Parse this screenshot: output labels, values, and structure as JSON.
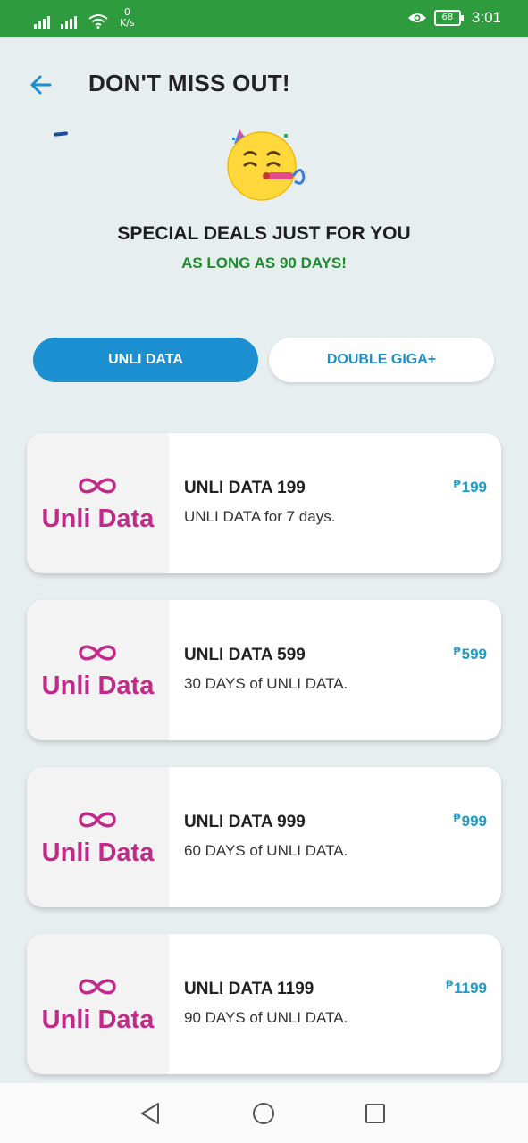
{
  "status_bar": {
    "speed_value": "0",
    "speed_unit": "K/s",
    "battery": "68",
    "time": "3:01"
  },
  "header": {
    "title": "DON'T MISS OUT!"
  },
  "promo": {
    "headline": "SPECIAL DEALS JUST FOR YOU",
    "subheadline": "AS LONG AS 90 DAYS!"
  },
  "tabs": [
    {
      "label": "UNLI DATA",
      "active": true
    },
    {
      "label": "DOUBLE GIGA+",
      "active": false
    }
  ],
  "currency_symbol": "₱",
  "logo_text": "Unli Data",
  "offers": [
    {
      "title": "UNLI DATA 199",
      "description": "UNLI DATA for 7 days.",
      "price": "199"
    },
    {
      "title": "UNLI DATA 599",
      "description": "30 DAYS of UNLI DATA.",
      "price": "599"
    },
    {
      "title": "UNLI DATA 999",
      "description": "60 DAYS of UNLI DATA.",
      "price": "999"
    },
    {
      "title": "UNLI DATA 1199",
      "description": "90 DAYS of UNLI DATA.",
      "price": "1199"
    }
  ],
  "colors": {
    "status_bar": "#2e9b3f",
    "accent_blue": "#1b8fd0",
    "promo_green": "#1f8a2e",
    "logo_magenta": "#c22a8a",
    "price_blue": "#1f9bc6"
  }
}
